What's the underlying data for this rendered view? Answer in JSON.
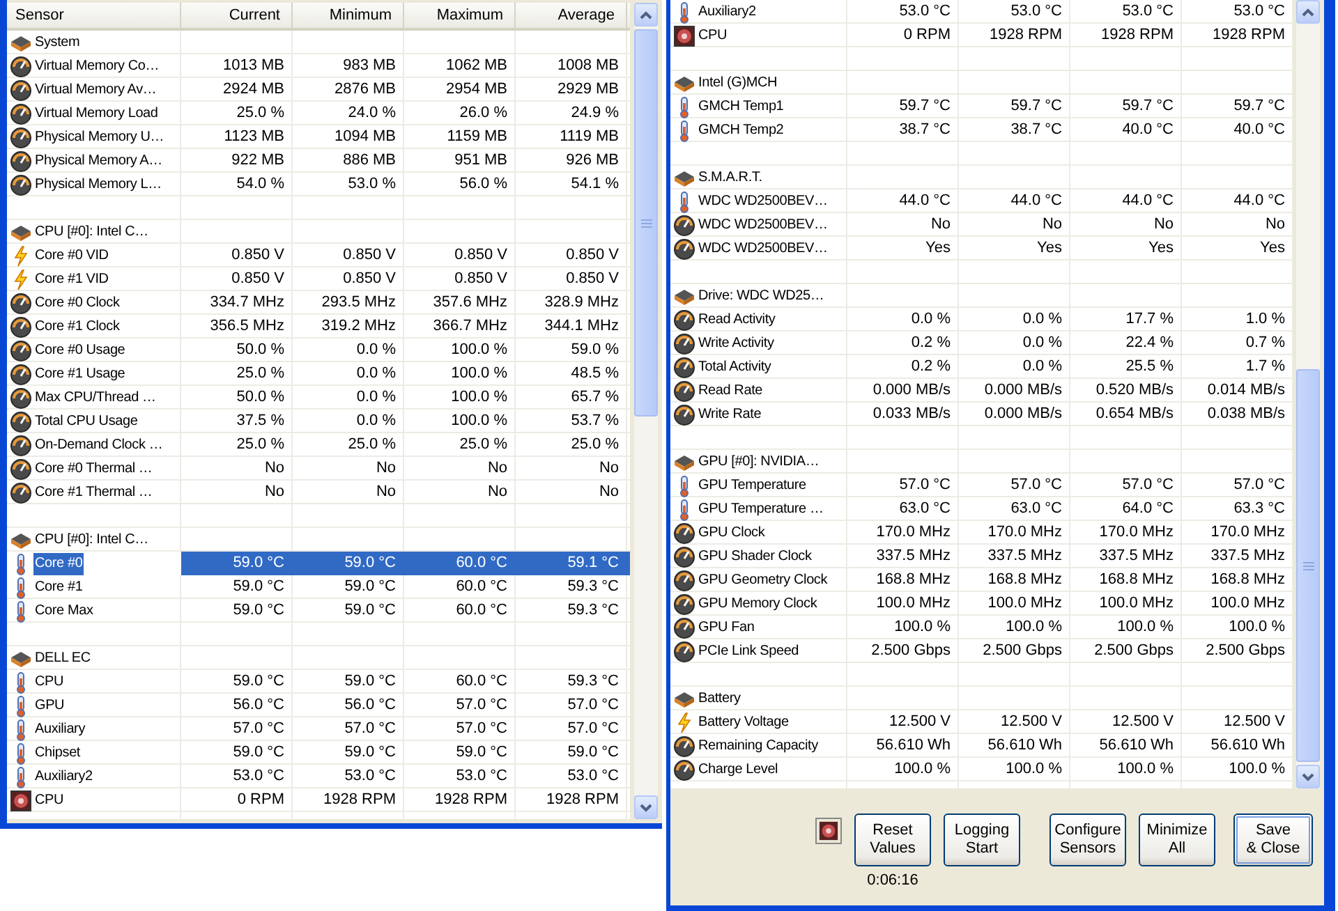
{
  "windows": [
    {
      "columns": [
        "Sensor",
        "Current",
        "Minimum",
        "Maximum",
        "Average"
      ],
      "groups": [
        {
          "name": "System",
          "sensors": [
            {
              "name": "Virtual Memory Co…",
              "kind": "gauge",
              "selected": false,
              "values": [
                "1013 MB",
                "983 MB",
                "1062 MB",
                "1008 MB"
              ]
            },
            {
              "name": "Virtual Memory Av…",
              "kind": "gauge",
              "selected": false,
              "values": [
                "2924 MB",
                "2876 MB",
                "2954 MB",
                "2929 MB"
              ]
            },
            {
              "name": "Virtual Memory Load",
              "kind": "gauge",
              "selected": false,
              "values": [
                "25.0 %",
                "24.0 %",
                "26.0 %",
                "24.9 %"
              ]
            },
            {
              "name": "Physical Memory U…",
              "kind": "gauge",
              "selected": false,
              "values": [
                "1123 MB",
                "1094 MB",
                "1159 MB",
                "1119 MB"
              ]
            },
            {
              "name": "Physical Memory A…",
              "kind": "gauge",
              "selected": false,
              "values": [
                "922 MB",
                "886 MB",
                "951 MB",
                "926 MB"
              ]
            },
            {
              "name": "Physical Memory L…",
              "kind": "gauge",
              "selected": false,
              "values": [
                "54.0 %",
                "53.0 %",
                "56.0 %",
                "54.1 %"
              ]
            }
          ]
        },
        {
          "name": "CPU [#0]: Intel C…",
          "sensors": [
            {
              "name": "Core #0 VID",
              "kind": "voltage",
              "selected": false,
              "values": [
                "0.850 V",
                "0.850 V",
                "0.850 V",
                "0.850 V"
              ]
            },
            {
              "name": "Core #1 VID",
              "kind": "voltage",
              "selected": false,
              "values": [
                "0.850 V",
                "0.850 V",
                "0.850 V",
                "0.850 V"
              ]
            },
            {
              "name": "Core #0 Clock",
              "kind": "gauge",
              "selected": false,
              "values": [
                "334.7 MHz",
                "293.5 MHz",
                "357.6 MHz",
                "328.9 MHz"
              ]
            },
            {
              "name": "Core #1 Clock",
              "kind": "gauge",
              "selected": false,
              "values": [
                "356.5 MHz",
                "319.2 MHz",
                "366.7 MHz",
                "344.1 MHz"
              ]
            },
            {
              "name": "Core #0 Usage",
              "kind": "gauge",
              "selected": false,
              "values": [
                "50.0 %",
                "0.0 %",
                "100.0 %",
                "59.0 %"
              ]
            },
            {
              "name": "Core #1 Usage",
              "kind": "gauge",
              "selected": false,
              "values": [
                "25.0 %",
                "0.0 %",
                "100.0 %",
                "48.5 %"
              ]
            },
            {
              "name": "Max CPU/Thread …",
              "kind": "gauge",
              "selected": false,
              "values": [
                "50.0 %",
                "0.0 %",
                "100.0 %",
                "65.7 %"
              ]
            },
            {
              "name": "Total CPU Usage",
              "kind": "gauge",
              "selected": false,
              "values": [
                "37.5 %",
                "0.0 %",
                "100.0 %",
                "53.7 %"
              ]
            },
            {
              "name": "On-Demand Clock …",
              "kind": "gauge",
              "selected": false,
              "values": [
                "25.0 %",
                "25.0 %",
                "25.0 %",
                "25.0 %"
              ]
            },
            {
              "name": "Core #0 Thermal …",
              "kind": "gauge",
              "selected": false,
              "values": [
                "No",
                "No",
                "No",
                "No"
              ]
            },
            {
              "name": "Core #1 Thermal …",
              "kind": "gauge",
              "selected": false,
              "values": [
                "No",
                "No",
                "No",
                "No"
              ]
            }
          ]
        },
        {
          "name": "CPU [#0]: Intel C…",
          "sensors": [
            {
              "name": "Core #0",
              "kind": "temperature",
              "selected": true,
              "values": [
                "59.0 °C",
                "59.0 °C",
                "60.0 °C",
                "59.1 °C"
              ]
            },
            {
              "name": "Core #1",
              "kind": "temperature",
              "selected": false,
              "values": [
                "59.0 °C",
                "59.0 °C",
                "60.0 °C",
                "59.3 °C"
              ]
            },
            {
              "name": "Core Max",
              "kind": "temperature",
              "selected": false,
              "values": [
                "59.0 °C",
                "59.0 °C",
                "60.0 °C",
                "59.3 °C"
              ]
            }
          ]
        },
        {
          "name": "DELL EC",
          "sensors": [
            {
              "name": "CPU",
              "kind": "temperature",
              "selected": false,
              "values": [
                "59.0 °C",
                "59.0 °C",
                "60.0 °C",
                "59.3 °C"
              ]
            },
            {
              "name": "GPU",
              "kind": "temperature",
              "selected": false,
              "values": [
                "56.0 °C",
                "56.0 °C",
                "57.0 °C",
                "57.0 °C"
              ]
            },
            {
              "name": "Auxiliary",
              "kind": "temperature",
              "selected": false,
              "values": [
                "57.0 °C",
                "57.0 °C",
                "57.0 °C",
                "57.0 °C"
              ]
            },
            {
              "name": "Chipset",
              "kind": "temperature",
              "selected": false,
              "values": [
                "59.0 °C",
                "59.0 °C",
                "59.0 °C",
                "59.0 °C"
              ]
            },
            {
              "name": "Auxiliary2",
              "kind": "temperature",
              "selected": false,
              "values": [
                "53.0 °C",
                "53.0 °C",
                "53.0 °C",
                "53.0 °C"
              ]
            },
            {
              "name": "CPU",
              "kind": "fan",
              "selected": false,
              "values": [
                "0 RPM",
                "1928 RPM",
                "1928 RPM",
                "1928 RPM"
              ]
            }
          ]
        }
      ]
    },
    {
      "groups": [
        {
          "sensors": [
            {
              "name": "Auxiliary2",
              "kind": "temperature",
              "selected": false,
              "values": [
                "53.0 °C",
                "53.0 °C",
                "53.0 °C",
                "53.0 °C"
              ]
            },
            {
              "name": "CPU",
              "kind": "fan",
              "selected": false,
              "values": [
                "0 RPM",
                "1928 RPM",
                "1928 RPM",
                "1928 RPM"
              ]
            }
          ]
        },
        {
          "name": "Intel (G)MCH",
          "sensors": [
            {
              "name": "GMCH Temp1",
              "kind": "temperature",
              "selected": false,
              "values": [
                "59.7 °C",
                "59.7 °C",
                "59.7 °C",
                "59.7 °C"
              ]
            },
            {
              "name": "GMCH Temp2",
              "kind": "temperature",
              "selected": false,
              "values": [
                "38.7 °C",
                "38.7 °C",
                "40.0 °C",
                "40.0 °C"
              ]
            }
          ]
        },
        {
          "name": "S.M.A.R.T.",
          "sensors": [
            {
              "name": "WDC WD2500BEV…",
              "kind": "temperature",
              "selected": false,
              "values": [
                "44.0 °C",
                "44.0 °C",
                "44.0 °C",
                "44.0 °C"
              ]
            },
            {
              "name": "WDC WD2500BEV…",
              "kind": "gauge",
              "selected": false,
              "values": [
                "No",
                "No",
                "No",
                "No"
              ]
            },
            {
              "name": "WDC WD2500BEV…",
              "kind": "gauge",
              "selected": false,
              "values": [
                "Yes",
                "Yes",
                "Yes",
                "Yes"
              ]
            }
          ]
        },
        {
          "name": "Drive: WDC WD25…",
          "sensors": [
            {
              "name": "Read Activity",
              "kind": "gauge",
              "selected": false,
              "values": [
                "0.0 %",
                "0.0 %",
                "17.7 %",
                "1.0 %"
              ]
            },
            {
              "name": "Write Activity",
              "kind": "gauge",
              "selected": false,
              "values": [
                "0.2 %",
                "0.0 %",
                "22.4 %",
                "0.7 %"
              ]
            },
            {
              "name": "Total Activity",
              "kind": "gauge",
              "selected": false,
              "values": [
                "0.2 %",
                "0.0 %",
                "25.5 %",
                "1.7 %"
              ]
            },
            {
              "name": "Read Rate",
              "kind": "gauge",
              "selected": false,
              "values": [
                "0.000 MB/s",
                "0.000 MB/s",
                "0.520 MB/s",
                "0.014 MB/s"
              ]
            },
            {
              "name": "Write Rate",
              "kind": "gauge",
              "selected": false,
              "values": [
                "0.033 MB/s",
                "0.000 MB/s",
                "0.654 MB/s",
                "0.038 MB/s"
              ]
            }
          ]
        },
        {
          "name": "GPU [#0]: NVIDIA…",
          "sensors": [
            {
              "name": "GPU Temperature",
              "kind": "temperature",
              "selected": false,
              "values": [
                "57.0 °C",
                "57.0 °C",
                "57.0 °C",
                "57.0 °C"
              ]
            },
            {
              "name": "GPU Temperature …",
              "kind": "temperature",
              "selected": false,
              "values": [
                "63.0 °C",
                "63.0 °C",
                "64.0 °C",
                "63.3 °C"
              ]
            },
            {
              "name": "GPU Clock",
              "kind": "gauge",
              "selected": false,
              "values": [
                "170.0 MHz",
                "170.0 MHz",
                "170.0 MHz",
                "170.0 MHz"
              ]
            },
            {
              "name": "GPU Shader Clock",
              "kind": "gauge",
              "selected": false,
              "values": [
                "337.5 MHz",
                "337.5 MHz",
                "337.5 MHz",
                "337.5 MHz"
              ]
            },
            {
              "name": "GPU Geometry Clock",
              "kind": "gauge",
              "selected": false,
              "values": [
                "168.8 MHz",
                "168.8 MHz",
                "168.8 MHz",
                "168.8 MHz"
              ]
            },
            {
              "name": "GPU Memory Clock",
              "kind": "gauge",
              "selected": false,
              "values": [
                "100.0 MHz",
                "100.0 MHz",
                "100.0 MHz",
                "100.0 MHz"
              ]
            },
            {
              "name": "GPU Fan",
              "kind": "gauge",
              "selected": false,
              "values": [
                "100.0 %",
                "100.0 %",
                "100.0 %",
                "100.0 %"
              ]
            },
            {
              "name": "PCIe Link Speed",
              "kind": "gauge",
              "selected": false,
              "values": [
                "2.500 Gbps",
                "2.500 Gbps",
                "2.500 Gbps",
                "2.500 Gbps"
              ]
            }
          ]
        },
        {
          "name": "Battery",
          "sensors": [
            {
              "name": "Battery Voltage",
              "kind": "voltage",
              "selected": false,
              "values": [
                "12.500 V",
                "12.500 V",
                "12.500 V",
                "12.500 V"
              ]
            },
            {
              "name": "Remaining Capacity",
              "kind": "gauge",
              "selected": false,
              "values": [
                "56.610 Wh",
                "56.610 Wh",
                "56.610 Wh",
                "56.610 Wh"
              ]
            },
            {
              "name": "Charge Level",
              "kind": "gauge",
              "selected": false,
              "values": [
                "100.0 %",
                "100.0 %",
                "100.0 %",
                "100.0 %"
              ]
            }
          ]
        }
      ],
      "buttons": [
        "Reset\nValues",
        "Logging\nStart",
        "Configure\nSensors",
        "Minimize\nAll",
        "Save\n& Close"
      ],
      "timer": "0:06:16"
    }
  ]
}
